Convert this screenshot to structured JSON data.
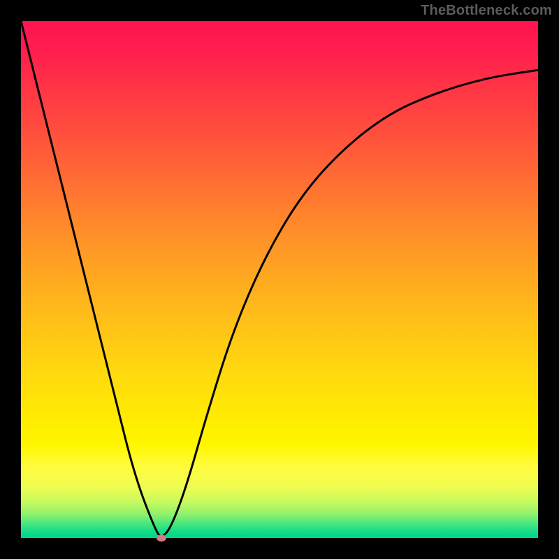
{
  "watermark": {
    "text": "TheBottleneck.com"
  },
  "chart_data": {
    "type": "line",
    "title": "",
    "xlabel": "",
    "ylabel": "",
    "xlim": [
      0,
      1
    ],
    "ylim": [
      0,
      1
    ],
    "x": [
      0.0,
      0.03,
      0.06,
      0.1,
      0.14,
      0.18,
      0.22,
      0.26,
      0.272,
      0.29,
      0.32,
      0.36,
      0.41,
      0.47,
      0.54,
      0.62,
      0.71,
      0.8,
      0.9,
      1.0
    ],
    "values": [
      1.0,
      0.88,
      0.76,
      0.6,
      0.44,
      0.28,
      0.12,
      0.015,
      0.0,
      0.02,
      0.1,
      0.24,
      0.4,
      0.54,
      0.66,
      0.75,
      0.82,
      0.86,
      0.89,
      0.905
    ],
    "min_point": {
      "x": 0.272,
      "y": 0.0,
      "color": "#d17c7e"
    },
    "curve_color": "#000000",
    "curve_width": 3,
    "gradient_stops": [
      {
        "pos": 0.0,
        "color": "#ff1450"
      },
      {
        "pos": 0.5,
        "color": "#ffb018"
      },
      {
        "pos": 0.8,
        "color": "#fff600"
      },
      {
        "pos": 1.0,
        "color": "#00d28c"
      }
    ]
  }
}
